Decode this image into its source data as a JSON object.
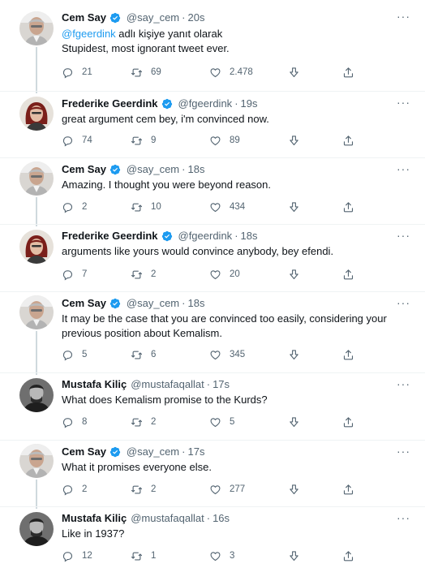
{
  "tweets": [
    {
      "name": "Cem Say",
      "verified": true,
      "handle": "@say_cem",
      "time": "20s",
      "replying_link": "@fgeerdink",
      "replying_rest": " adlı kişiye yanıt olarak",
      "lines": [
        "Stupidest, most ignorant tweet ever."
      ],
      "replies": "21",
      "retweets": "69",
      "likes": "2.478",
      "avatar": "cem"
    },
    {
      "name": "Frederike Geerdink",
      "verified": true,
      "handle": "@fgeerdink",
      "time": "19s",
      "lines": [
        "great argument cem bey, i'm convinced now."
      ],
      "replies": "74",
      "retweets": "9",
      "likes": "89",
      "avatar": "frederike"
    },
    {
      "name": "Cem Say",
      "verified": true,
      "handle": "@say_cem",
      "time": "18s",
      "lines": [
        "Amazing. I thought you were beyond reason."
      ],
      "replies": "2",
      "retweets": "10",
      "likes": "434",
      "avatar": "cem"
    },
    {
      "name": "Frederike Geerdink",
      "verified": true,
      "handle": "@fgeerdink",
      "time": "18s",
      "lines": [
        "arguments like yours would convince anybody, bey efendi."
      ],
      "replies": "7",
      "retweets": "2",
      "likes": "20",
      "avatar": "frederike"
    },
    {
      "name": "Cem Say",
      "verified": true,
      "handle": "@say_cem",
      "time": "18s",
      "lines": [
        "It may be the case that you are convinced too easily, considering your",
        "previous position about Kemalism."
      ],
      "replies": "5",
      "retweets": "6",
      "likes": "345",
      "avatar": "cem"
    },
    {
      "name": "Mustafa Kiliç",
      "verified": false,
      "handle": "@mustafaqallat",
      "time": "17s",
      "lines": [
        "What does Kemalism promise to the Kurds?"
      ],
      "replies": "8",
      "retweets": "2",
      "likes": "5",
      "avatar": "mustafa"
    },
    {
      "name": "Cem Say",
      "verified": true,
      "handle": "@say_cem",
      "time": "17s",
      "lines": [
        "What it promises everyone else."
      ],
      "replies": "2",
      "retweets": "2",
      "likes": "277",
      "avatar": "cem"
    },
    {
      "name": "Mustafa Kiliç",
      "verified": false,
      "handle": "@mustafaqallat",
      "time": "16s",
      "lines": [
        "Like in 1937?"
      ],
      "replies": "12",
      "retweets": "1",
      "likes": "3",
      "avatar": "mustafa"
    }
  ],
  "ui": {
    "more_glyph": "···",
    "dot": "·",
    "icons": [
      "reply-icon",
      "retweet-icon",
      "like-icon",
      "downvote-icon",
      "share-icon",
      "verified-badge-icon",
      "more-icon"
    ],
    "colors": {
      "link": "#1d9bf0",
      "secondary": "#536471",
      "verified": "#1d9bf0",
      "thread": "#cfd9de"
    }
  }
}
